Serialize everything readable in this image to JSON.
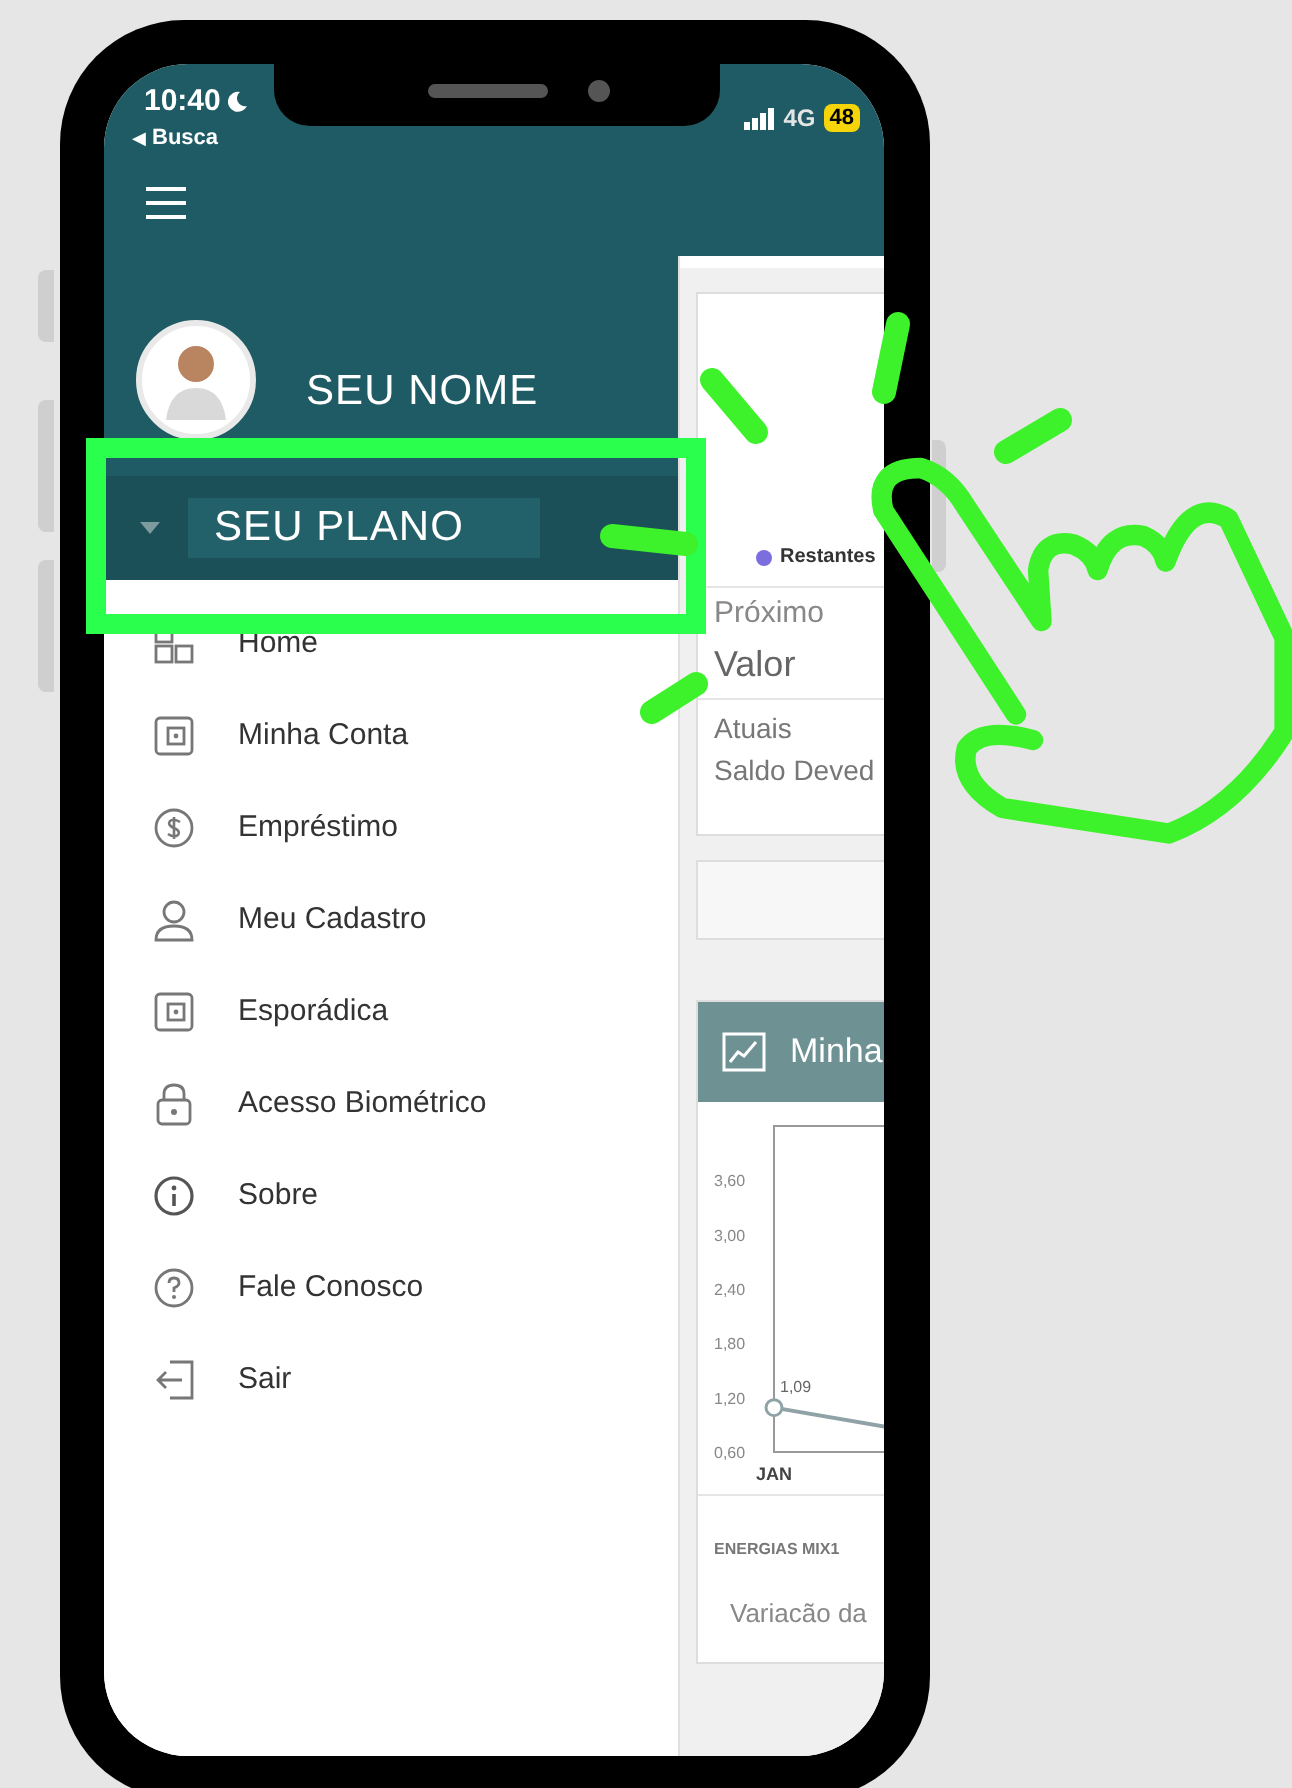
{
  "status_bar": {
    "time": "10:40",
    "back_icon": "◀",
    "back_label": "Busca",
    "network": "4G",
    "battery": "48"
  },
  "drawer": {
    "user_name": "SEU NOME",
    "plan": "SEU PLANO"
  },
  "menu": [
    {
      "label": "Home",
      "kind": "home"
    },
    {
      "label": "Minha Conta",
      "kind": "wallet"
    },
    {
      "label": "Empréstimo",
      "kind": "dollar"
    },
    {
      "label": "Meu Cadastro",
      "kind": "user"
    },
    {
      "label": "Esporádica",
      "kind": "wallet"
    },
    {
      "label": "Acesso Biométrico",
      "kind": "lock"
    },
    {
      "label": "Sobre",
      "kind": "info"
    },
    {
      "label": "Fale Conosco",
      "kind": "help"
    },
    {
      "label": "Sair",
      "kind": "exit"
    }
  ],
  "summary_card": {
    "legend": "Restantes",
    "next_label": "Próximo",
    "value_label": "Valor",
    "current_label": "Atuais",
    "balance_label": "Saldo Deved"
  },
  "chart_card": {
    "title": "Minha",
    "chart_data": {
      "type": "line",
      "categories": [
        "JAN"
      ],
      "series": [
        {
          "color": "#8fa3a6",
          "values": [
            1.09
          ],
          "marker": "circle"
        }
      ],
      "ylim": [
        0.6,
        4.2
      ],
      "yticks": [
        {
          "value": 3.6,
          "label": "3,60"
        },
        {
          "value": 3.0,
          "label": "3,00"
        },
        {
          "value": 2.4,
          "label": "2,40"
        },
        {
          "value": 1.8,
          "label": "1,80"
        },
        {
          "value": 1.2,
          "label": "1,20"
        },
        {
          "value": 0.6,
          "label": "0,60"
        }
      ],
      "value_labels": [
        "1,09"
      ]
    },
    "fund": "ENERGIAS MIX1",
    "caption": "Variacão da"
  }
}
